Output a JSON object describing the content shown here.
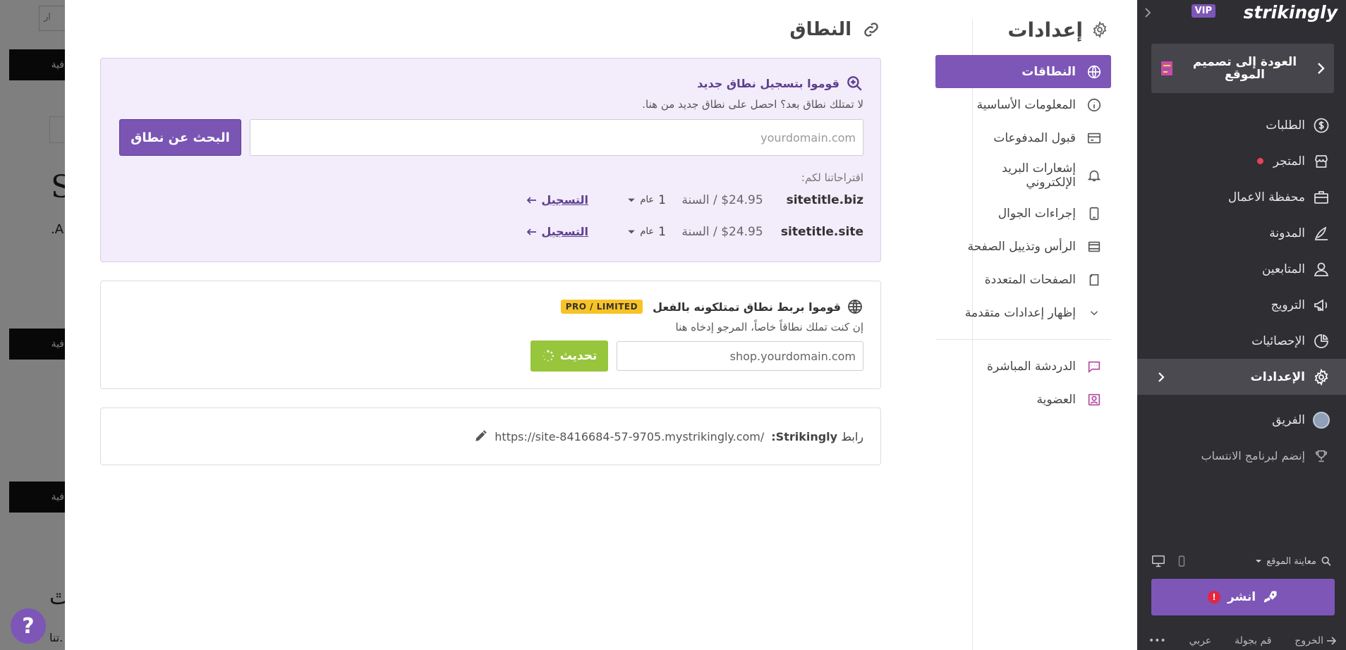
{
  "background": {
    "btn_text": "فية",
    "search_placeholder": "ار",
    "big_letter": "S",
    "small_text": ".A",
    "bottom_letter": "ٿ",
    "bottom_text": "تنا."
  },
  "help": {
    "label": "?"
  },
  "settings": {
    "title": "إعدادات",
    "nav": [
      {
        "label": "النطاقات",
        "icon": "globe-icon",
        "active": true
      },
      {
        "label": "المعلومات الأساسية",
        "icon": "info-icon"
      },
      {
        "label": "قبول المدفوعات",
        "icon": "payment-icon"
      },
      {
        "label": "إشعارات البريد الإلكتروني",
        "icon": "bell-icon"
      },
      {
        "label": "إجراءات الجوال",
        "icon": "mobile-icon"
      },
      {
        "label": "الرأس وتذييل الصفحة",
        "icon": "header-footer-icon"
      },
      {
        "label": "الصفحات المتعددة",
        "icon": "pages-icon"
      },
      {
        "label": "إظهار إعدادات متقدمة",
        "icon": "chevron-down-icon"
      }
    ],
    "extra": [
      {
        "label": "الدردشة المباشرة",
        "icon": "chat-icon"
      },
      {
        "label": "العضوية",
        "icon": "membership-icon"
      }
    ]
  },
  "domain": {
    "title": "النطاق",
    "register": {
      "heading": "قوموا بتسجيل نطاق جديد",
      "subtext": "لا تمتلك نطاق بعد؟ احصل على نطاق جديد من هنا.",
      "placeholder": "yourdomain.com",
      "search_button": "البحث عن نطاق",
      "suggest_label": "اقتراحاتنا لكم:",
      "suggestions": [
        {
          "domain": "sitetitle.biz",
          "price": "$24.95 / السنة",
          "term_num": "1",
          "term_unit": "عام",
          "register": "التسجيل"
        },
        {
          "domain": "sitetitle.site",
          "price": "$24.95 / السنة",
          "term_num": "1",
          "term_unit": "عام",
          "register": "التسجيل"
        }
      ]
    },
    "connect": {
      "heading": "قوموا بربط نطاق تمتلكونه بالفعل",
      "badge": "PRO / LIMITED",
      "subtext": "إن كنت تملك نطاقاً خاصاً، المرجو إدخاه هنا",
      "placeholder": "shop.yourdomain.com",
      "update_button": "تحديث"
    },
    "link": {
      "label_prefix": "رابط",
      "label_brand": "Strikingly:",
      "url": "https://site-8416684-57-9705.mystrikingly.com/"
    }
  },
  "sidebar": {
    "logo": "strikingly",
    "vip": "VIP",
    "back": "العودة إلى تصميم الموقع",
    "items": [
      {
        "label": "الطلبات",
        "icon": "dollar-icon"
      },
      {
        "label": "المتجر",
        "icon": "store-icon",
        "dot": true
      },
      {
        "label": "محفظة الاعمال",
        "icon": "briefcase-icon"
      },
      {
        "label": "المدونة",
        "icon": "pen-icon"
      },
      {
        "label": "المتابعين",
        "icon": "followers-icon"
      },
      {
        "label": "الترويج",
        "icon": "megaphone-icon"
      },
      {
        "label": "الإحصائيات",
        "icon": "pie-chart-icon"
      },
      {
        "label": "الإعدادات",
        "icon": "gear-icon",
        "active": true
      }
    ],
    "team": "الفريق",
    "affiliate": "إنضم لبرنامج الانتساب",
    "preview": "معاينة الموقع",
    "publish": "انشر",
    "publish_alert": "!",
    "bottom": {
      "exit": "الخروج",
      "tour": "قم بجولة",
      "language": "عربي",
      "more": "•••"
    }
  },
  "colors": {
    "accent": "#7d56b8",
    "update": "#97c53c",
    "badge": "#f7c325",
    "sidebar_bg": "#2e2e33"
  }
}
